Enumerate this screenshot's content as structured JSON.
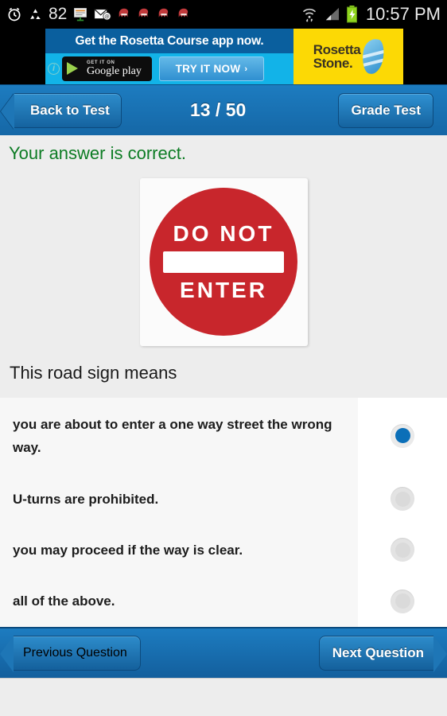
{
  "statusbar": {
    "icons_left": [
      {
        "name": "alarm-clock-icon",
        "glyph": "alarm"
      },
      {
        "name": "recycle-icon",
        "glyph": "recycle"
      },
      {
        "name": "battery-percent-label",
        "glyph": "82"
      },
      {
        "name": "presentation-board-icon",
        "glyph": "board"
      },
      {
        "name": "email-at-icon",
        "glyph": "mail-at"
      },
      {
        "name": "octopus-notification-icon-1",
        "glyph": "octopus"
      },
      {
        "name": "octopus-notification-icon-2",
        "glyph": "octopus"
      },
      {
        "name": "octopus-notification-icon-3",
        "glyph": "octopus"
      },
      {
        "name": "octopus-notification-icon-4",
        "glyph": "octopus"
      }
    ],
    "battery_percent": "82",
    "wifi_icon": "wifi-updown-icon",
    "signal_icon": "cell-signal-icon",
    "battery_icon": "battery-charging-icon",
    "clock": "10:57 PM"
  },
  "ad": {
    "headline": "Get the Rosetta Course app now.",
    "google_play_top": "GET IT ON",
    "google_play_bottom": "Google play",
    "cta_label": "TRY IT NOW",
    "cta_chevron": "›",
    "info_badge": "i",
    "brand_line1": "Rosetta",
    "brand_line2": "Stone.",
    "brand_color": "#fcd905"
  },
  "topnav": {
    "back_label": "Back to Test",
    "counter": "13 / 50",
    "grade_label": "Grade Test",
    "bg_color": "#1567a6"
  },
  "feedback": {
    "text": "Your answer is correct.",
    "color": "#0d7c24"
  },
  "sign": {
    "line1": "DO NOT",
    "line2": "ENTER",
    "color": "#c8262c",
    "alt": "do-not-enter-road-sign"
  },
  "question": {
    "text": "This road sign means"
  },
  "options": [
    {
      "label": "you are about to enter a one way street the wrong way.",
      "selected": true
    },
    {
      "label": "U-turns are prohibited.",
      "selected": false
    },
    {
      "label": "you may proceed if the way is clear.",
      "selected": false
    },
    {
      "label": "all of the above.",
      "selected": false
    }
  ],
  "botnav": {
    "previous_label": "Previous Question",
    "next_label": "Next Question"
  }
}
